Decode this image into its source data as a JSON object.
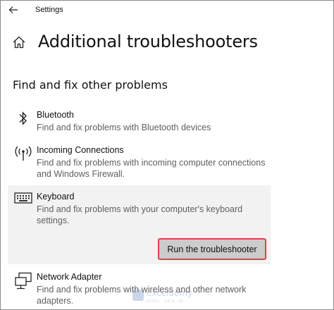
{
  "window": {
    "title": "Settings"
  },
  "header": {
    "title": "Additional troubleshooters"
  },
  "section": {
    "title": "Find and fix other problems"
  },
  "items": [
    {
      "name": "Bluetooth",
      "desc": "Find and fix problems with Bluetooth devices",
      "icon": "bluetooth-icon"
    },
    {
      "name": "Incoming Connections",
      "desc": "Find and fix problems with incoming computer connections and Windows Firewall.",
      "icon": "antenna-icon"
    },
    {
      "name": "Keyboard",
      "desc": "Find and fix problems with your computer's keyboard settings.",
      "icon": "keyboard-icon",
      "button_label": "Run the troubleshooter"
    },
    {
      "name": "Network Adapter",
      "desc": "Find and fix problems with wireless and other network adapters.",
      "icon": "network-adapter-icon"
    }
  ],
  "watermark": {
    "brand": "exceldemy",
    "tagline": "EXCEL · DATA · BI"
  },
  "colors": {
    "selected_bg": "#f2f2f2",
    "button_bg": "#cccccc",
    "highlight": "#e0404a"
  }
}
